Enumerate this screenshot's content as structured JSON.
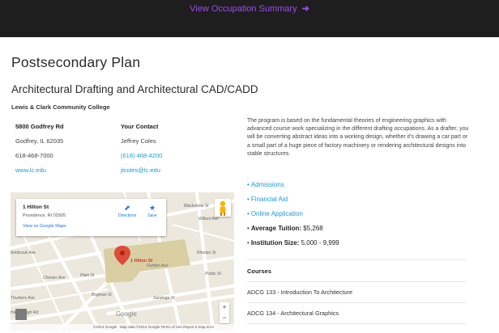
{
  "topbar": {
    "link_label": "View Occupation Summary",
    "arrow": "➜"
  },
  "page_title": "Postsecondary Plan",
  "program_title": "Architectural Drafting and Architectural CAD/CADD",
  "college_name": "Lewis & Clark Community College",
  "address": {
    "street": "5800 Godfrey Rd",
    "city": "Godfrey, IL 62035",
    "phone": "618-468-7000",
    "website": "www.lc.edu"
  },
  "contact": {
    "header": "Your Contact",
    "name": "Jeffrey Coles",
    "phone": "(618) 468-4200",
    "email": "jtcoles@lc.edu"
  },
  "description": "The program is based on the fundamental theories of engineering graphics with advanced course work specializing in the different drafting occupations. As a drafter, you will be converting abstract ideas into a working design, whether it's drawing a car part or a small part of a huge piece of factory machinery or rendering architectural designs into stable structures.",
  "links": {
    "admissions": "Admissions",
    "financial_aid": "Financial Aid",
    "online_application": "Online Application",
    "tuition_label": "Average Tuition:",
    "tuition_value": "$5,268",
    "size_label": "Institution Size:",
    "size_value": "5,000 - 9,999"
  },
  "courses": {
    "header": "Courses",
    "items": [
      "ADCG 133 - Introduction To Architecture",
      "ADCG 134 - Architectural Graphics"
    ]
  },
  "map": {
    "card_title": "1 Hilton St",
    "card_subtitle": "Providence, RI 02905",
    "card_link": "View on Google Maps",
    "directions_label": "Directions",
    "save_label": "Save",
    "pin_label": "1 Hilton St",
    "google_logo": "Google",
    "footer_text": "©2014 Google · Map data ©2014 Google   Terms of Use   Report a map error",
    "zoom_in": "+",
    "zoom_out": "−",
    "streets": [
      "Blackstone St",
      "Willard Ave",
      "Public St",
      "Gordon Ave",
      "Chester Ave",
      "Bogman St",
      "Saratoga St",
      "Rhodes St",
      "Thurbers Ave",
      "Plain St",
      "Harborough Rd",
      "Ashbrook Ave"
    ],
    "colors": {
      "land": "#ece8dd",
      "road": "#ffffff",
      "campus": "#d9cfa3",
      "pin": "#dd4b39"
    }
  },
  "colors": {
    "accent_purple": "#9b4de0",
    "link_blue": "#1a9ad6",
    "topbar": "#1e1e1e"
  }
}
